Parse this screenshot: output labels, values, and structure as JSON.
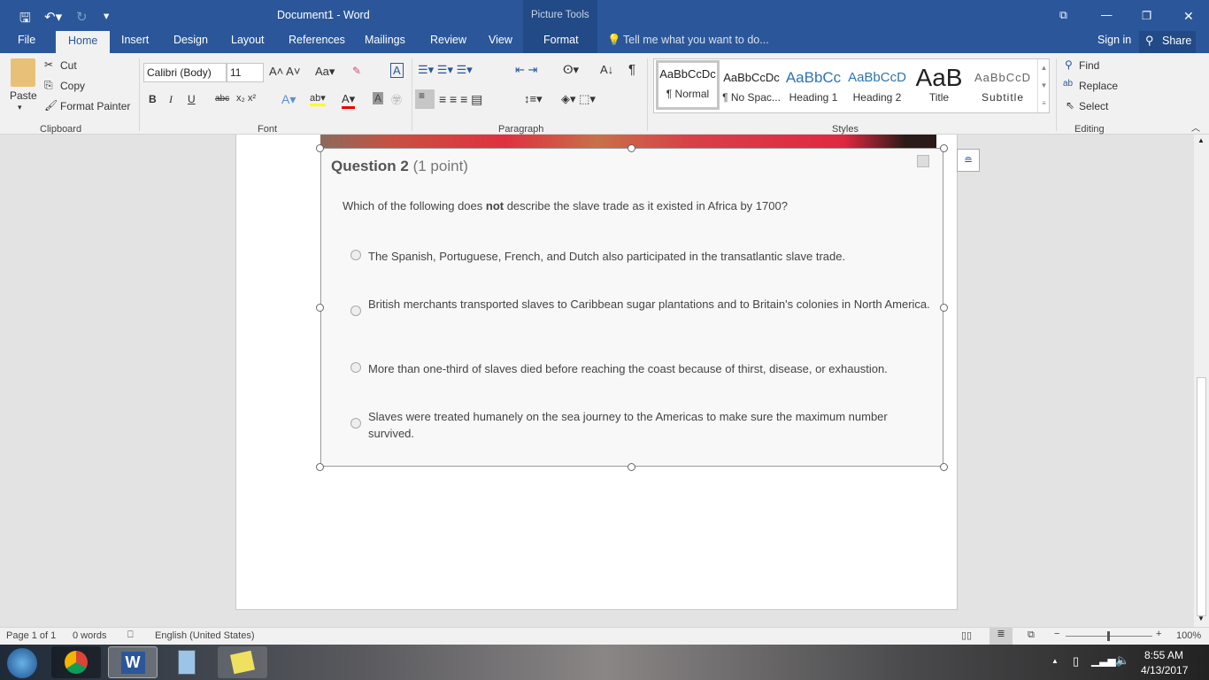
{
  "titlebar": {
    "doc_title": "Document1 - Word",
    "context": "Picture Tools",
    "tell_me": "Tell me what you want to do...",
    "sign_in": "Sign in",
    "share": "Share"
  },
  "tabs": [
    "File",
    "Home",
    "Insert",
    "Design",
    "Layout",
    "References",
    "Mailings",
    "Review",
    "View",
    "Format"
  ],
  "clipboard": {
    "paste": "Paste",
    "cut": "Cut",
    "copy": "Copy",
    "format_painter": "Format Painter",
    "group": "Clipboard"
  },
  "font": {
    "name": "Calibri (Body)",
    "size": "11",
    "group": "Font",
    "bold": "B",
    "italic": "I",
    "underline": "U"
  },
  "paragraph": {
    "group": "Paragraph"
  },
  "styles": {
    "group": "Styles",
    "items": [
      {
        "preview": "AaBbCcDc",
        "label": "¶ Normal"
      },
      {
        "preview": "AaBbCcDc",
        "label": "¶ No Spac..."
      },
      {
        "preview": "AaBbCc",
        "label": "Heading 1"
      },
      {
        "preview": "AaBbCcD",
        "label": "Heading 2"
      },
      {
        "preview": "AaB",
        "label": "Title"
      },
      {
        "preview": "AaBbCcD",
        "label": "Subtitle"
      }
    ]
  },
  "editing": {
    "find": "Find",
    "replace": "Replace",
    "select": "Select",
    "group": "Editing"
  },
  "question": {
    "title": "Question 2",
    "points": "(1 point)",
    "prompt_before": "Which of the following does ",
    "prompt_bold": "not",
    "prompt_after": " describe the slave trade as it existed in Africa by 1700?",
    "options": [
      "The Spanish, Portuguese, French, and Dutch also participated in the transatlantic slave trade.",
      "British merchants transported slaves to Caribbean sugar plantations and to Britain's colonies in North America.",
      "More than one-third of slaves died before reaching the coast because of thirst, disease, or exhaustion.",
      "Slaves were treated humanely on the sea journey to the Americas to make sure the maximum number survived."
    ]
  },
  "status": {
    "page": "Page 1 of 1",
    "words": "0 words",
    "language": "English (United States)",
    "zoom": "100%"
  },
  "taskbar": {
    "time": "8:55 AM",
    "date": "4/13/2017"
  },
  "colors": {
    "word_blue": "#2b579a"
  }
}
